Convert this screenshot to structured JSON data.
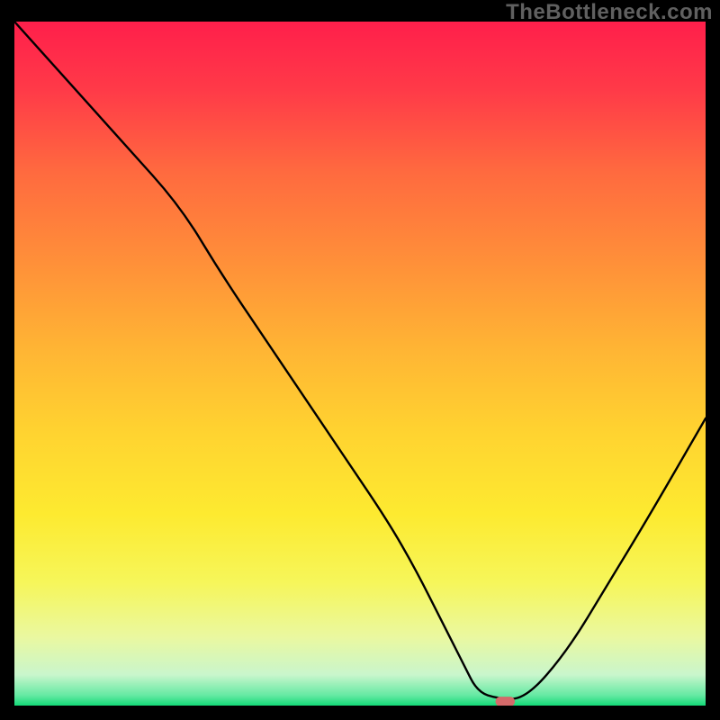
{
  "watermark": "TheBottleneck.com",
  "chart_data": {
    "type": "line",
    "title": "",
    "xlabel": "",
    "ylabel": "",
    "xlim": [
      0,
      100
    ],
    "ylim": [
      0,
      100
    ],
    "x": [
      0,
      8,
      16,
      24,
      30,
      36,
      42,
      48,
      54,
      58,
      62,
      65,
      67,
      70,
      74,
      80,
      86,
      92,
      100
    ],
    "values": [
      100,
      91,
      82,
      73,
      63,
      54,
      45,
      36,
      27,
      20,
      12,
      6,
      2,
      1,
      1,
      8,
      18,
      28,
      42
    ],
    "marker": {
      "x": 71,
      "y": 0.6,
      "w": 2.8,
      "h": 1.4,
      "color": "#d46a6a"
    },
    "gradient_stops": [
      {
        "offset": 0.0,
        "color": "#ff1f4b"
      },
      {
        "offset": 0.1,
        "color": "#ff3a48"
      },
      {
        "offset": 0.22,
        "color": "#ff6a3f"
      },
      {
        "offset": 0.35,
        "color": "#ff8f39"
      },
      {
        "offset": 0.48,
        "color": "#ffb534"
      },
      {
        "offset": 0.6,
        "color": "#ffd330"
      },
      {
        "offset": 0.72,
        "color": "#fdea30"
      },
      {
        "offset": 0.82,
        "color": "#f6f65a"
      },
      {
        "offset": 0.9,
        "color": "#eaf8a0"
      },
      {
        "offset": 0.955,
        "color": "#c9f6cc"
      },
      {
        "offset": 0.985,
        "color": "#65e9a3"
      },
      {
        "offset": 1.0,
        "color": "#13d977"
      }
    ]
  }
}
